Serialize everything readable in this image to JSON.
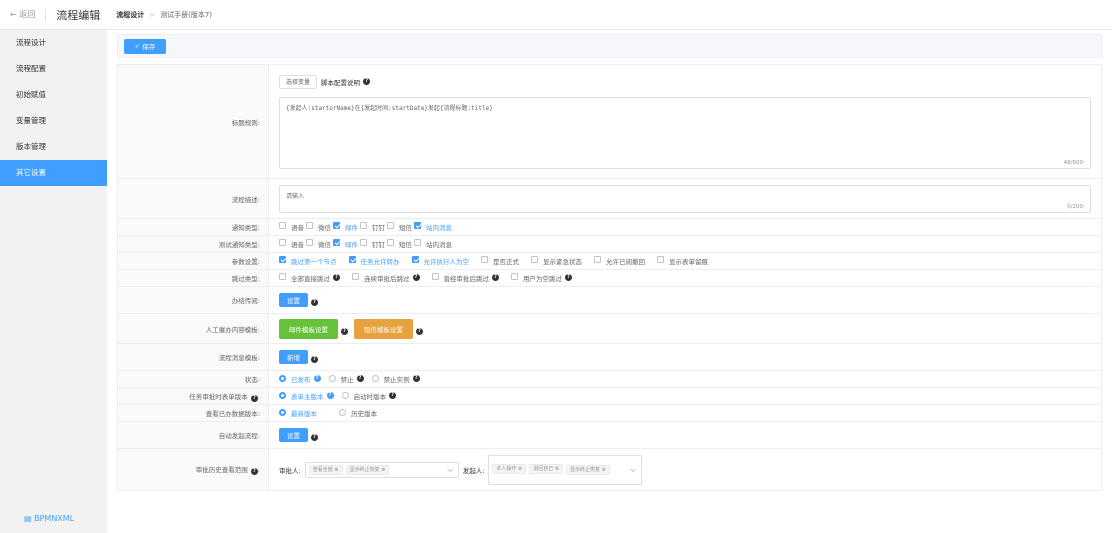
{
  "header": {
    "back_label": "← 返回",
    "page_title": "流程编辑",
    "breadcrumb_current": "流程设计",
    "breadcrumb_sub": "测试手册(版本7)"
  },
  "sidebar": {
    "items": [
      {
        "label": "流程设计"
      },
      {
        "label": "流程配置"
      },
      {
        "label": "初始赋值"
      },
      {
        "label": "变量管理"
      },
      {
        "label": "版本管理"
      },
      {
        "label": "其它设置"
      }
    ],
    "active_index": 5,
    "footer": "BPMNXML"
  },
  "toolbar": {
    "save_label": "保存"
  },
  "form": {
    "title_rule": {
      "label": "标题规则:",
      "var_button": "选择变量",
      "script_desc": "脚本配置说明",
      "value": "{发起人:startorName}在{发起时间:startDate}发起{流程标题:title}",
      "count": "48/600"
    },
    "desc": {
      "label": "流程描述:",
      "placeholder": "请输入",
      "count": "0/200"
    },
    "notify_type": {
      "label": "通知类型:",
      "options": [
        {
          "label": "语音",
          "checked": false
        },
        {
          "label": "微信",
          "checked": false
        },
        {
          "label": "邮件",
          "checked": true
        },
        {
          "label": "钉钉",
          "checked": false
        },
        {
          "label": "短信",
          "checked": false
        },
        {
          "label": "站内消息",
          "checked": true
        }
      ]
    },
    "test_notify_type": {
      "label": "测试通知类型:",
      "options": [
        {
          "label": "语音",
          "checked": false
        },
        {
          "label": "微信",
          "checked": false
        },
        {
          "label": "邮件",
          "checked": true
        },
        {
          "label": "钉钉",
          "checked": false
        },
        {
          "label": "短信",
          "checked": false
        },
        {
          "label": "站内消息",
          "checked": false
        }
      ]
    },
    "params": {
      "label": "参数设置:",
      "options": [
        {
          "label": "跳过第一个节点",
          "checked": true
        },
        {
          "label": "任务允许转办",
          "checked": true
        },
        {
          "label": "允许执行人为空",
          "checked": true
        },
        {
          "label": "是否正式",
          "checked": false
        },
        {
          "label": "显示紧急状态",
          "checked": false
        },
        {
          "label": "允许已阅撤回",
          "checked": false
        },
        {
          "label": "显示表单留痕",
          "checked": false
        }
      ]
    },
    "skip_type": {
      "label": "跳过类型:",
      "options": [
        {
          "label": "全部直接跳过",
          "checked": false
        },
        {
          "label": "连续审批后跳过",
          "checked": false
        },
        {
          "label": "曾经审批后跳过",
          "checked": false
        },
        {
          "label": "用户为空跳过",
          "checked": false
        }
      ]
    },
    "office_time": {
      "label": "办结传阅:",
      "button": "设置"
    },
    "urge_template": {
      "label": "人工催办内容模板:",
      "mail_button": "邮件模板设置",
      "sms_button": "短信模板设置"
    },
    "msg_template": {
      "label": "流程消息模板:",
      "button": "新增"
    },
    "status": {
      "label": "状态:",
      "options": [
        {
          "label": "已发布",
          "checked": true
        },
        {
          "label": "禁止",
          "checked": false
        },
        {
          "label": "禁止实例",
          "checked": false
        }
      ]
    },
    "task_form_version": {
      "label": "任务审批时表单版本",
      "options": [
        {
          "label": "表单主版本",
          "checked": true
        },
        {
          "label": "启动时版本",
          "checked": false
        }
      ]
    },
    "view_data_version": {
      "label": "查看已办数据版本:",
      "options": [
        {
          "label": "最新版本",
          "checked": true
        },
        {
          "label": "历史版本",
          "checked": false
        }
      ]
    },
    "auto_start": {
      "label": "自动发起流程:",
      "button": "设置"
    },
    "history_scope": {
      "label": "审批历史查看范围",
      "approver_label": "审批人:",
      "approver_tags": [
        "查看全部",
        "显示终止恢复"
      ],
      "starter_label": "发起人:",
      "starter_tags": [
        "本人操作",
        "退回自己",
        "显示终止恢复"
      ]
    }
  },
  "colors": {
    "primary": "#409eff",
    "success": "#67c23a",
    "warning": "#e6a23c"
  }
}
